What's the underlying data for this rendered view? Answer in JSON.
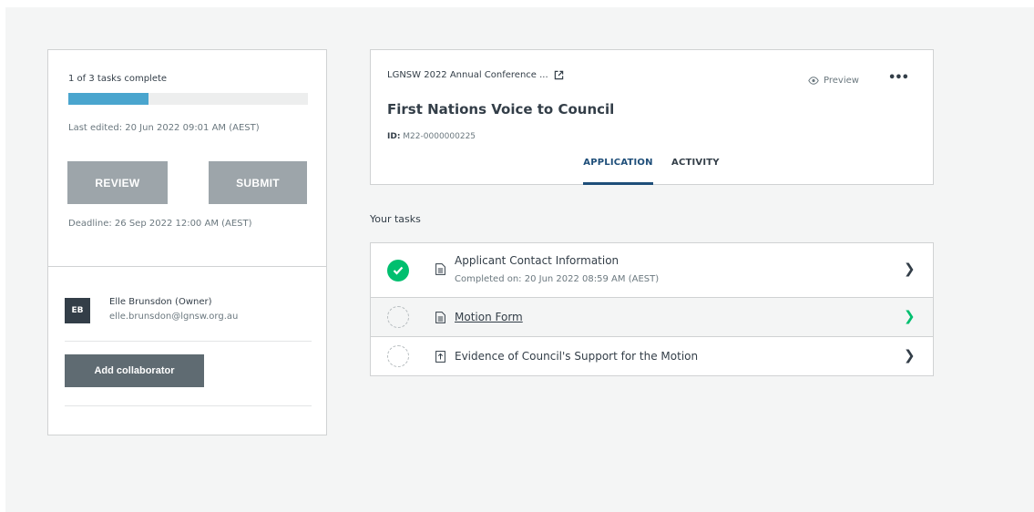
{
  "progress": {
    "label": "1 of 3 tasks complete",
    "fraction": 0.333,
    "color": "#4aa5ce"
  },
  "last_edited": "Last edited: 20 Jun 2022 09:01 AM (AEST)",
  "buttons": {
    "review": "REVIEW",
    "submit": "SUBMIT",
    "add_collaborator": "Add collaborator"
  },
  "deadline": "Deadline: 26 Sep 2022 12:00 AM (AEST)",
  "owner": {
    "initials": "EB",
    "name": "Elle Brunsdon (Owner)",
    "email": "elle.brunsdon@lgnsw.org.au"
  },
  "header": {
    "conference_link": "LGNSW 2022 Annual Conference ...",
    "preview": "Preview",
    "title": "First Nations Voice to Council",
    "id_label": "ID:",
    "id_value": "M22-0000000225",
    "tabs": [
      {
        "label": "APPLICATION",
        "active": true
      },
      {
        "label": "ACTIVITY",
        "active": false
      }
    ]
  },
  "tasks_heading": "Your tasks",
  "tasks": [
    {
      "title": "Applicant Contact Information",
      "subtitle": "Completed on: 20 Jun 2022 08:59 AM (AEST)",
      "status": "complete",
      "icon": "document-icon"
    },
    {
      "title": "Motion Form",
      "subtitle": "",
      "status": "incomplete",
      "icon": "document-icon"
    },
    {
      "title": "Evidence of Council's Support for the Motion",
      "subtitle": "",
      "status": "incomplete",
      "icon": "upload-icon"
    }
  ],
  "colors": {
    "accent_green": "#00bf6f",
    "tab_active": "#1e4e79",
    "button_grey": "#9da5aa",
    "button_dark": "#5f6b72"
  }
}
